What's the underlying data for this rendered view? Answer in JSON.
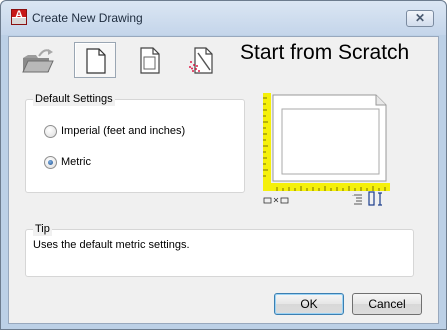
{
  "window": {
    "title": "Create New Drawing",
    "close_symbol": "✕",
    "app_icon_letter": "A"
  },
  "toolbar": {
    "buttons": [
      {
        "name": "open-drawing-folder-icon",
        "selected": false
      },
      {
        "name": "start-from-scratch-icon",
        "selected": true
      },
      {
        "name": "use-template-icon",
        "selected": false
      },
      {
        "name": "use-wizard-icon",
        "selected": false
      }
    ]
  },
  "heading": "Start from Scratch",
  "default_settings": {
    "legend": "Default Settings",
    "options": [
      {
        "label": "Imperial (feet and inches)",
        "checked": false
      },
      {
        "label": "Metric",
        "checked": true
      }
    ]
  },
  "tip": {
    "legend": "Tip",
    "text": "Uses the default metric settings."
  },
  "buttons": {
    "ok": "OK",
    "cancel": "Cancel"
  },
  "colors": {
    "ruler": "#f5f00a",
    "frame": "#bcd0e6"
  }
}
